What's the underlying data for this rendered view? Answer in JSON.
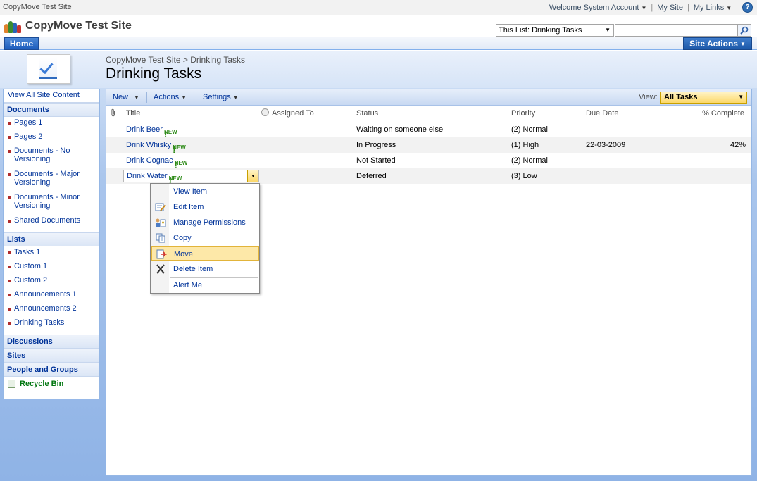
{
  "global": {
    "site_small": "CopyMove Test Site",
    "welcome": "Welcome System Account",
    "my_site": "My Site",
    "my_links": "My Links"
  },
  "header": {
    "site_title": "CopyMove Test Site",
    "search_scope": "This List: Drinking Tasks",
    "search_placeholder": ""
  },
  "topnav": {
    "home_tab": "Home",
    "site_actions": "Site Actions"
  },
  "page": {
    "breadcrumb_site": "CopyMove Test Site",
    "breadcrumb_sep": ">",
    "breadcrumb_current": "Drinking Tasks",
    "title": "Drinking Tasks"
  },
  "leftnav": {
    "view_all": "View All Site Content",
    "documents_head": "Documents",
    "documents": [
      "Pages 1",
      "Pages 2",
      "Documents - No Versioning",
      "Documents - Major Versioning",
      "Documents - Minor Versioning",
      "Shared Documents"
    ],
    "lists_head": "Lists",
    "lists": [
      "Tasks 1",
      "Custom 1",
      "Custom 2",
      "Announcements 1",
      "Announcements 2",
      "Drinking Tasks"
    ],
    "discussions_head": "Discussions",
    "sites_head": "Sites",
    "people_head": "People and Groups",
    "recycle_bin": "Recycle Bin"
  },
  "toolbar": {
    "new": "New",
    "actions": "Actions",
    "settings": "Settings",
    "view_label": "View:",
    "view_value": "All Tasks"
  },
  "columns": {
    "title": "Title",
    "assigned_to": "Assigned To",
    "status": "Status",
    "priority": "Priority",
    "due_date": "Due Date",
    "percent": "% Complete"
  },
  "rows": [
    {
      "title": "Drink Beer",
      "badge": "NEW",
      "status": "Waiting on someone else",
      "priority": "(2) Normal",
      "due": "",
      "percent": ""
    },
    {
      "title": "Drink Whisky",
      "badge": "NEW",
      "status": "In Progress",
      "priority": "(1) High",
      "due": "22-03-2009",
      "percent": "42%"
    },
    {
      "title": "Drink Cognac",
      "badge": "NEW",
      "status": "Not Started",
      "priority": "(2) Normal",
      "due": "",
      "percent": ""
    },
    {
      "title": "Drink Water",
      "badge": "NEW",
      "status": "Deferred",
      "priority": "(3) Low",
      "due": "",
      "percent": ""
    }
  ],
  "context_menu": {
    "items": [
      "View Item",
      "Edit Item",
      "Manage Permissions",
      "Copy",
      "Move",
      "Delete Item",
      "Alert Me"
    ],
    "active": "Move"
  },
  "colors": {
    "link": "#003399",
    "accent_blue": "#1d5dbd",
    "highlight": "#fde8a8",
    "new_green": "#2e8b19"
  }
}
